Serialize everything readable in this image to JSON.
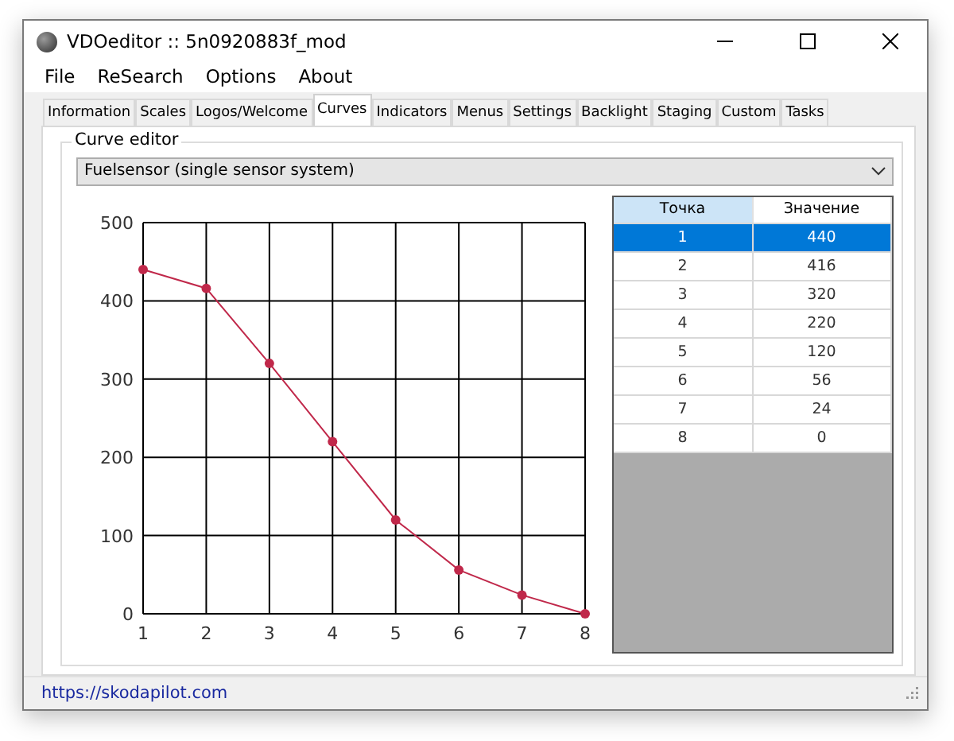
{
  "window": {
    "title": "VDOeditor :: 5n0920883f_mod"
  },
  "menu": [
    "File",
    "ReSearch",
    "Options",
    "About"
  ],
  "tabs": [
    {
      "label": "Information",
      "selected": false
    },
    {
      "label": "Scales",
      "selected": false
    },
    {
      "label": "Logos/Welcome",
      "selected": false
    },
    {
      "label": "Curves",
      "selected": true
    },
    {
      "label": "Indicators",
      "selected": false
    },
    {
      "label": "Menus",
      "selected": false
    },
    {
      "label": "Settings",
      "selected": false
    },
    {
      "label": "Backlight",
      "selected": false
    },
    {
      "label": "Staging",
      "selected": false
    },
    {
      "label": "Custom",
      "selected": false
    },
    {
      "label": "Tasks",
      "selected": false
    }
  ],
  "group": {
    "title": "Curve editor",
    "dropdown": {
      "value": "Fuelsensor (single sensor system)"
    },
    "chart": {
      "chart_data": {
        "type": "line",
        "x": [
          1,
          2,
          3,
          4,
          5,
          6,
          7,
          8
        ],
        "series": [
          {
            "color": "#c0284a",
            "marker": true,
            "values": [
              440,
              416,
              320,
              220,
              120,
              56,
              24,
              0
            ]
          }
        ],
        "grid": true,
        "xlim": [
          1,
          8
        ],
        "ylim": [
          0,
          500
        ],
        "xticks": [
          1,
          2,
          3,
          4,
          5,
          6,
          7,
          8
        ],
        "yticks": [
          0,
          100,
          200,
          300,
          400,
          500
        ]
      }
    },
    "table": {
      "columns": [
        {
          "label": "Точка",
          "selected": true
        },
        {
          "label": "Значение",
          "selected": false
        }
      ],
      "rows": [
        {
          "cells": [
            "1",
            "440"
          ],
          "selected": true
        },
        {
          "cells": [
            "2",
            "416"
          ],
          "selected": false
        },
        {
          "cells": [
            "3",
            "320"
          ],
          "selected": false
        },
        {
          "cells": [
            "4",
            "220"
          ],
          "selected": false
        },
        {
          "cells": [
            "5",
            "120"
          ],
          "selected": false
        },
        {
          "cells": [
            "6",
            "56"
          ],
          "selected": false
        },
        {
          "cells": [
            "7",
            "24"
          ],
          "selected": false
        },
        {
          "cells": [
            "8",
            "0"
          ],
          "selected": false
        }
      ]
    }
  },
  "status_bar": {
    "link": "https://skodapilot.com"
  }
}
